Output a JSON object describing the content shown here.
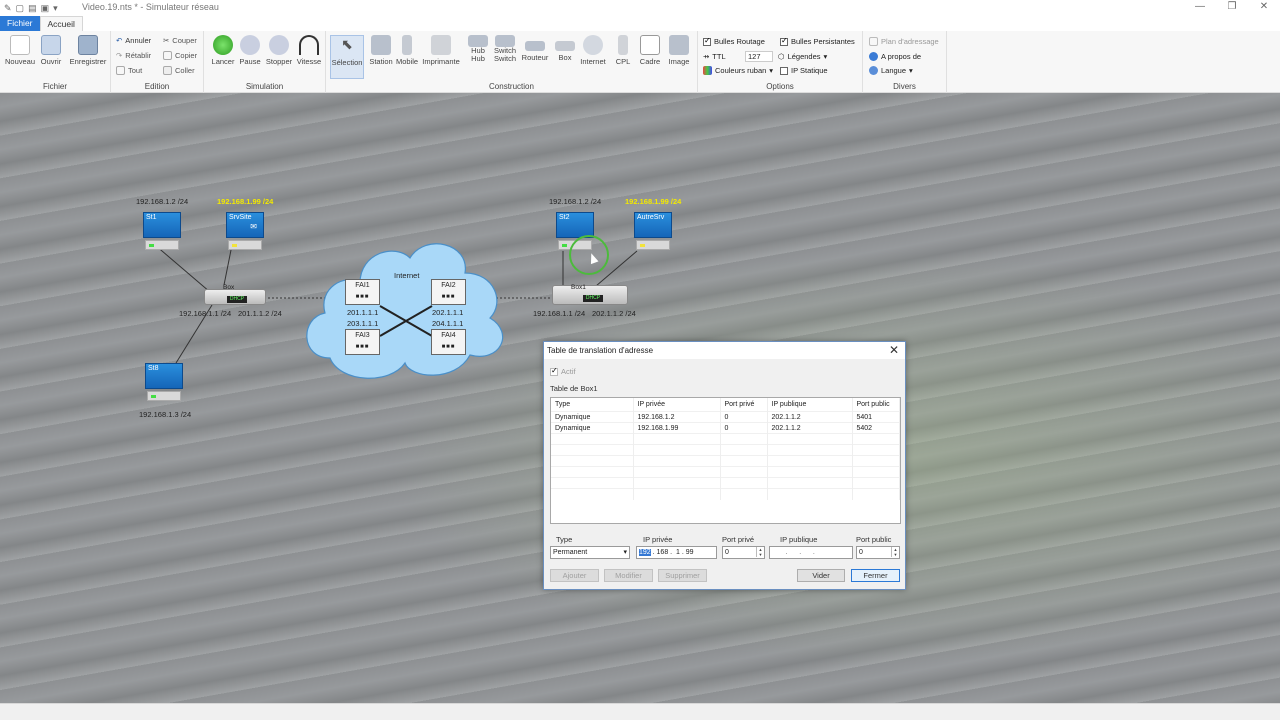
{
  "window": {
    "title": "Video.19.nts * - Simulateur réseau"
  },
  "menu": {
    "file": "Fichier",
    "home": "Accueil"
  },
  "ribbon": {
    "fichier": {
      "name": "Fichier",
      "nouveau": "Nouveau",
      "ouvrir": "Ouvrir",
      "enregistrer": "Enregistrer"
    },
    "edition": {
      "name": "Edition",
      "annuler": "Annuler",
      "retablir": "Rétablir",
      "tout": "Tout",
      "couper": "Couper",
      "copier": "Copier",
      "coller": "Coller"
    },
    "simulation": {
      "name": "Simulation",
      "lancer": "Lancer",
      "pause": "Pause",
      "stopper": "Stopper",
      "vitesse": "Vitesse"
    },
    "construction": {
      "name": "Construction",
      "selection": "Sélection",
      "station": "Station",
      "mobile": "Mobile",
      "imprimante": "Imprimante",
      "hub": "Hub",
      "hub_top": "Hub",
      "switch": "Switch",
      "switch_top": "Switch",
      "routeur": "Routeur",
      "box": "Box",
      "internet": "Internet",
      "cpl": "CPL",
      "cadre": "Cadre",
      "image": "Image"
    },
    "options": {
      "name": "Options",
      "bulles_routage": "Bulles Routage",
      "bulles_persistantes": "Bulles Persistantes",
      "ttl": "TTL",
      "ttl_value": "127",
      "legendes": "Légendes",
      "couleurs_ruban": "Couleurs ruban",
      "ip_statique": "IP Statique"
    },
    "divers": {
      "name": "Divers",
      "plan": "Plan d'adressage",
      "apropos": "A propos de",
      "langue": "Langue"
    }
  },
  "network": {
    "st1": {
      "name": "St1",
      "ip": "192.168.1.2 /24"
    },
    "srvsite": {
      "name": "SrvSite",
      "ip": "192.168.1.99 /24"
    },
    "st8": {
      "name": "St8",
      "ip": "192.168.1.3 /24"
    },
    "box_left": {
      "name": "Box",
      "lan_ip": "192.168.1.1 /24",
      "wan_ip": "201.1.1.2 /24"
    },
    "st2": {
      "name": "St2",
      "ip": "192.168.1.2 /24"
    },
    "autresrv": {
      "name": "AutreSrv",
      "ip": "192.168.1.99 /24"
    },
    "box1": {
      "name": "Box1",
      "lan_ip": "192.168.1.1 /24",
      "wan_ip": "202.1.1.2 /24"
    },
    "internet": {
      "label": "Internet"
    },
    "fai1": {
      "name": "FAI1",
      "ip": "201.1.1.1"
    },
    "fai2": {
      "name": "FAI2",
      "ip": "202.1.1.1"
    },
    "fai3": {
      "name": "FAI3",
      "ip": "203.1.1.1"
    },
    "fai4": {
      "name": "FAI4",
      "ip": "204.1.1.1"
    }
  },
  "dialog": {
    "title": "Table de translation d'adresse",
    "actif": "Actif",
    "table_label": "Table de Box1",
    "headers": [
      "Type",
      "IP privée",
      "Port privé",
      "IP publique",
      "Port public"
    ],
    "rows": [
      [
        "Dynamique",
        "192.168.1.2",
        "0",
        "202.1.1.2",
        "5401"
      ],
      [
        "Dynamique",
        "192.168.1.99",
        "0",
        "202.1.1.2",
        "5402"
      ]
    ],
    "form": {
      "type_label": "Type",
      "type_value": "Permanent",
      "ip_privee_label": "IP privée",
      "ip_o1": "192",
      "ip_o2": "168",
      "ip_o3": "1",
      "ip_o4": "99",
      "port_prive_label": "Port privé",
      "port_prive_value": "0",
      "ip_publique_label": "IP publique",
      "port_public_label": "Port public",
      "port_public_value": "0"
    },
    "buttons": {
      "ajouter": "Ajouter",
      "modifier": "Modifier",
      "supprimer": "Supprimer",
      "vider": "Vider",
      "fermer": "Fermer"
    }
  }
}
